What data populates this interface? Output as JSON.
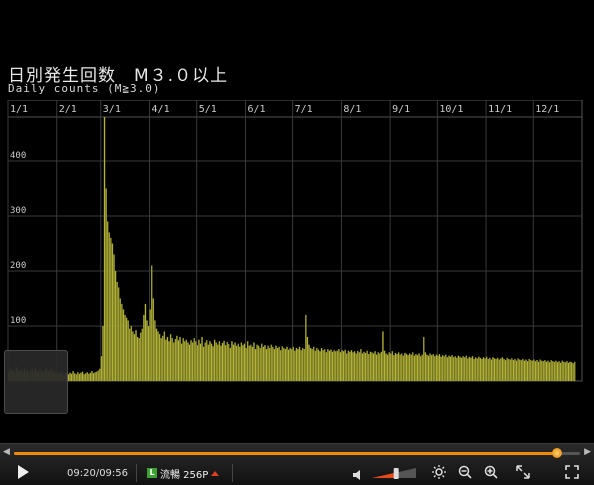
{
  "title": {
    "main": "日別発生回数　M３.０以上",
    "sub": "Daily counts (M≧3.0)"
  },
  "colors": {
    "bar": "#b4b43a",
    "bar_edge": "#6f6f1e",
    "grid": "#3a3a3a",
    "accent": "#f08a00"
  },
  "chart_data": {
    "type": "bar",
    "title": "日別発生回数　M３.０以上",
    "subtitle": "Daily counts (M≧3.0)",
    "xlabel": "",
    "ylabel": "",
    "x_ticks": [
      "1/1",
      "2/1",
      "3/1",
      "4/1",
      "5/1",
      "6/1",
      "7/1",
      "8/1",
      "9/1",
      "10/1",
      "11/1",
      "12/1"
    ],
    "x_tick_days": [
      0,
      31,
      59,
      90,
      120,
      151,
      181,
      212,
      243,
      273,
      304,
      334
    ],
    "y_ticks": [
      100,
      200,
      300,
      400
    ],
    "ylim": [
      0,
      480
    ],
    "grid": true,
    "days_total": 365,
    "values": [
      15,
      22,
      18,
      20,
      14,
      25,
      19,
      17,
      21,
      16,
      23,
      18,
      20,
      15,
      19,
      22,
      17,
      24,
      18,
      16,
      21,
      19,
      15,
      20,
      23,
      17,
      18,
      22,
      16,
      19,
      14,
      12,
      15,
      13,
      17,
      11,
      14,
      16,
      12,
      15,
      13,
      18,
      14,
      12,
      16,
      13,
      15,
      17,
      12,
      14,
      16,
      13,
      15,
      18,
      14,
      16,
      17,
      19,
      22,
      45,
      100,
      480,
      350,
      290,
      270,
      260,
      250,
      230,
      200,
      180,
      170,
      150,
      140,
      130,
      120,
      115,
      110,
      95,
      100,
      90,
      85,
      92,
      80,
      78,
      88,
      95,
      120,
      140,
      110,
      100,
      130,
      210,
      150,
      110,
      95,
      90,
      85,
      78,
      82,
      90,
      75,
      80,
      72,
      85,
      78,
      70,
      76,
      82,
      74,
      80,
      68,
      78,
      72,
      75,
      70,
      66,
      74,
      70,
      78,
      72,
      65,
      75,
      68,
      80,
      62,
      70,
      74,
      66,
      72,
      68,
      63,
      75,
      70,
      66,
      72,
      64,
      69,
      73,
      65,
      71,
      67,
      60,
      72,
      66,
      70,
      64,
      68,
      62,
      70,
      65,
      68,
      60,
      72,
      64,
      66,
      62,
      70,
      58,
      66,
      64,
      60,
      68,
      62,
      65,
      58,
      64,
      60,
      66,
      62,
      58,
      64,
      60,
      62,
      56,
      63,
      60,
      58,
      62,
      57,
      60,
      58,
      62,
      55,
      60,
      58,
      62,
      56,
      60,
      58,
      120,
      80,
      66,
      60,
      58,
      62,
      55,
      60,
      57,
      54,
      60,
      56,
      58,
      52,
      58,
      55,
      57,
      53,
      56,
      54,
      55,
      58,
      52,
      56,
      54,
      57,
      50,
      55,
      53,
      56,
      52,
      54,
      50,
      55,
      52,
      58,
      50,
      53,
      51,
      55,
      49,
      53,
      52,
      50,
      54,
      48,
      52,
      50,
      53,
      90,
      55,
      50,
      48,
      52,
      50,
      54,
      47,
      51,
      49,
      52,
      48,
      50,
      46,
      51,
      49,
      47,
      50,
      48,
      52,
      46,
      49,
      47,
      50,
      45,
      48,
      80,
      52,
      48,
      46,
      50,
      47,
      49,
      45,
      48,
      46,
      49,
      44,
      47,
      45,
      48,
      43,
      46,
      44,
      47,
      43,
      45,
      42,
      46,
      44,
      42,
      45,
      43,
      46,
      41,
      44,
      42,
      45,
      40,
      43,
      41,
      44,
      42,
      40,
      43,
      41,
      44,
      40,
      42,
      39,
      43,
      41,
      40,
      42,
      39,
      41,
      43,
      40,
      38,
      42,
      40,
      39,
      41,
      38,
      40,
      37,
      41,
      39,
      38,
      40,
      37,
      39,
      36,
      40,
      38,
      37,
      39,
      36,
      38,
      35,
      39,
      37,
      36,
      38,
      35,
      37,
      34,
      38,
      36,
      35,
      37,
      34,
      36,
      33,
      37,
      35,
      34,
      36,
      33,
      35,
      34,
      32,
      35
    ]
  },
  "player": {
    "seek_left_icon": "seek-back-icon",
    "seek_right_icon": "seek-forward-icon",
    "progress_fraction": 0.96,
    "time": "09:20/09:56",
    "quality_badge": "L",
    "quality_label": "流暢 256P",
    "volume_level": 0.55,
    "icons": [
      "play-icon",
      "volume-icon",
      "brightness-icon",
      "zoom-out-icon",
      "zoom-in-icon",
      "expand-icon",
      "fullscreen-icon"
    ]
  }
}
